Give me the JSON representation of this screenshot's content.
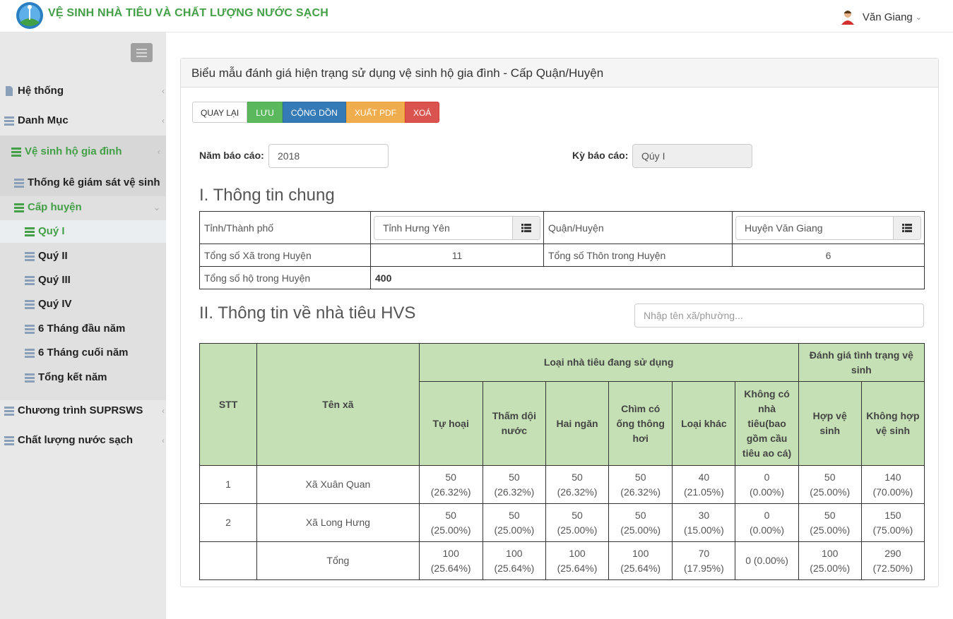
{
  "header": {
    "app_title": "VỆ SINH NHÀ TIÊU VÀ CHẤT LƯỢNG NƯỚC SẠCH",
    "user_name": "Văn Giang"
  },
  "sidebar": {
    "items": [
      {
        "label": "Hệ thống"
      },
      {
        "label": "Danh Mục"
      },
      {
        "label": "Vệ sinh hộ gia đình"
      },
      {
        "label": "Thống kê giám sát vệ sinh"
      },
      {
        "label": "Cấp huyện"
      },
      {
        "label": "Quý I"
      },
      {
        "label": "Quý II"
      },
      {
        "label": "Quý III"
      },
      {
        "label": "Quý IV"
      },
      {
        "label": "6 Tháng đầu năm"
      },
      {
        "label": "6 Tháng cuối năm"
      },
      {
        "label": "Tổng kết năm"
      },
      {
        "label": "Chương trình SUPRSWS"
      },
      {
        "label": "Chất lượng nước sạch"
      }
    ]
  },
  "panel": {
    "title": "Biểu mẫu đánh giá hiện trạng sử dụng vệ sinh hộ gia đình - Cấp Quận/Huyện"
  },
  "buttons": {
    "back": "QUAY LẠI",
    "save": "LƯU",
    "sum": "CỘNG DỒN",
    "pdf": "XUẤT PDF",
    "delete": "XOÁ"
  },
  "form": {
    "year_label": "Năm báo cáo:",
    "year_value": "2018",
    "period_label": "Kỳ báo cáo:",
    "period_value": "Qúy I"
  },
  "section1": {
    "title": "I. Thông tin chung",
    "province_label": "Tỉnh/Thành phố",
    "province_value": "Tỉnh Hưng Yên",
    "district_label": "Quận/Huyện",
    "district_value": "Huyện Văn Giang",
    "communes_label": "Tổng số Xã trong Huyện",
    "communes_value": "11",
    "hamlets_label": "Tổng số Thôn trong Huyện",
    "hamlets_value": "6",
    "households_label": "Tổng số hộ trong Huyện",
    "households_value": "400"
  },
  "section2": {
    "title": "II. Thông tin về nhà tiêu HVS",
    "search_placeholder": "Nhập tên xã/phường..."
  },
  "table": {
    "h_stt": "STT",
    "h_name": "Tên xã",
    "h_group1": "Loại nhà tiêu đang sử dụng",
    "h_group2": "Đánh giá tình trạng vệ sinh",
    "cols": [
      "Tự hoại",
      "Thấm dội nước",
      "Hai ngăn",
      "Chìm có ống thông hơi",
      "Loại khác",
      "Không có nhà tiêu(bao gồm cầu tiêu ao cá)",
      "Hợp vệ sinh",
      "Không hợp vệ sinh"
    ],
    "rows": [
      {
        "stt": "1",
        "name": "Xã Xuân Quan",
        "cells": [
          [
            "50",
            "(26.32%)"
          ],
          [
            "50",
            "(26.32%)"
          ],
          [
            "50",
            "(26.32%)"
          ],
          [
            "50",
            "(26.32%)"
          ],
          [
            "40",
            "(21.05%)"
          ],
          [
            "0",
            "(0.00%)"
          ],
          [
            "50",
            "(25.00%)"
          ],
          [
            "140",
            "(70.00%)"
          ]
        ]
      },
      {
        "stt": "2",
        "name": "Xã Long Hưng",
        "cells": [
          [
            "50",
            "(25.00%)"
          ],
          [
            "50",
            "(25.00%)"
          ],
          [
            "50",
            "(25.00%)"
          ],
          [
            "50",
            "(25.00%)"
          ],
          [
            "30",
            "(15.00%)"
          ],
          [
            "0",
            "(0.00%)"
          ],
          [
            "50",
            "(25.00%)"
          ],
          [
            "150",
            "(75.00%)"
          ]
        ]
      },
      {
        "stt": "",
        "name": "Tổng",
        "cells": [
          [
            "100",
            "(25.64%)"
          ],
          [
            "100",
            "(25.64%)"
          ],
          [
            "100",
            "(25.64%)"
          ],
          [
            "100",
            "(25.64%)"
          ],
          [
            "70",
            "(17.95%)"
          ],
          [
            "0 (0.00%)",
            ""
          ],
          [
            "100",
            "(25.00%)"
          ],
          [
            "290",
            "(72.50%)"
          ]
        ]
      }
    ]
  },
  "colors": {
    "brand_green": "#43a047",
    "header_green_cell": "#c5e0b4",
    "btn_green": "#5cb85c",
    "btn_blue": "#337ab7",
    "btn_orange": "#f0ad4e",
    "btn_red": "#d9534f"
  }
}
